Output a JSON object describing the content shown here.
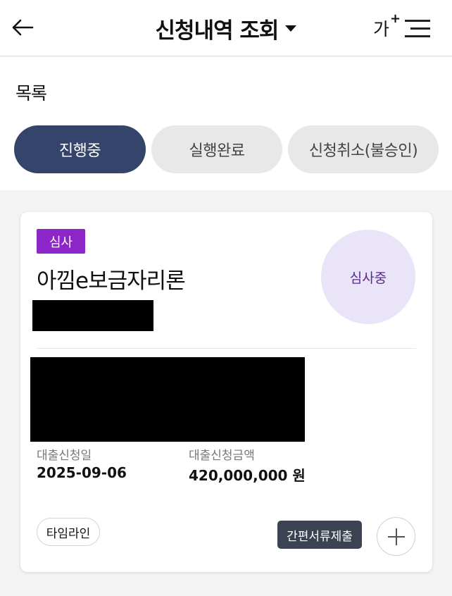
{
  "header": {
    "title": "신청내역 조회",
    "font_size_label": "가",
    "font_size_plus": "+"
  },
  "list": {
    "section_title": "목록",
    "tabs": [
      {
        "label": "진행중",
        "active": true
      },
      {
        "label": "실행완료",
        "active": false
      },
      {
        "label": "신청취소(불승인)",
        "active": false
      }
    ]
  },
  "card": {
    "badge": "심사",
    "product_name": "아낌e보금자리론",
    "status": "심사중",
    "apply_date_label": "대출신청일",
    "apply_date": "2025-09-06",
    "apply_amount_label": "대출신청금액",
    "apply_amount": "420,000,000 원",
    "timeline_label": "타임라인",
    "simple_doc_label": "간편서류제출"
  },
  "colors": {
    "active_tab": "#34446a",
    "badge": "#8d26c9",
    "status_circle": "#e9e4f8",
    "doc_button": "#3b4352"
  }
}
